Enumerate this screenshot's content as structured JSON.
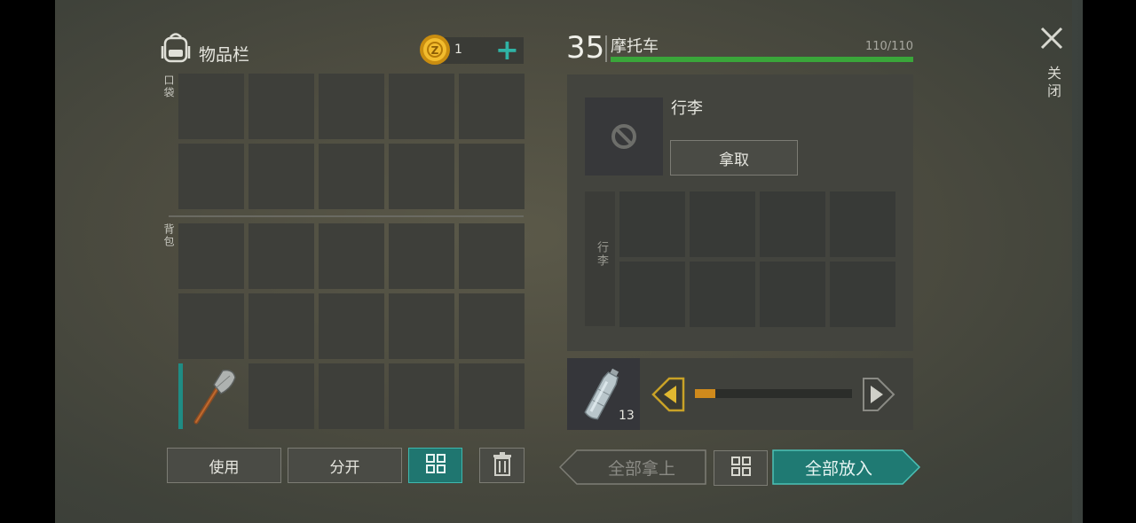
{
  "inventory": {
    "title": "物品栏",
    "coins": "1",
    "add_label": "+",
    "pocket_label": "口袋",
    "backpack_label": "背包",
    "shovel_item": "shovel-icon"
  },
  "vehicle": {
    "level": "35",
    "name": "摩托车",
    "durability": "110/110",
    "durability_fraction": 1.0,
    "luggage_title": "行李",
    "take_label": "拿取",
    "luggage_grid_label": "行李"
  },
  "transfer": {
    "item_count": "13",
    "item_icon": "water-bottle-icon",
    "slider_fraction": 0.13
  },
  "buttons": {
    "use": "使用",
    "split": "分开",
    "take_all": "全部拿上",
    "put_all": "全部放入"
  },
  "close": {
    "label": "关闭"
  },
  "colors": {
    "accent_teal": "#1f7670",
    "durability_green": "#3aa63a",
    "slider_orange": "#d08a1c",
    "arrow_gold": "#c9a227"
  }
}
